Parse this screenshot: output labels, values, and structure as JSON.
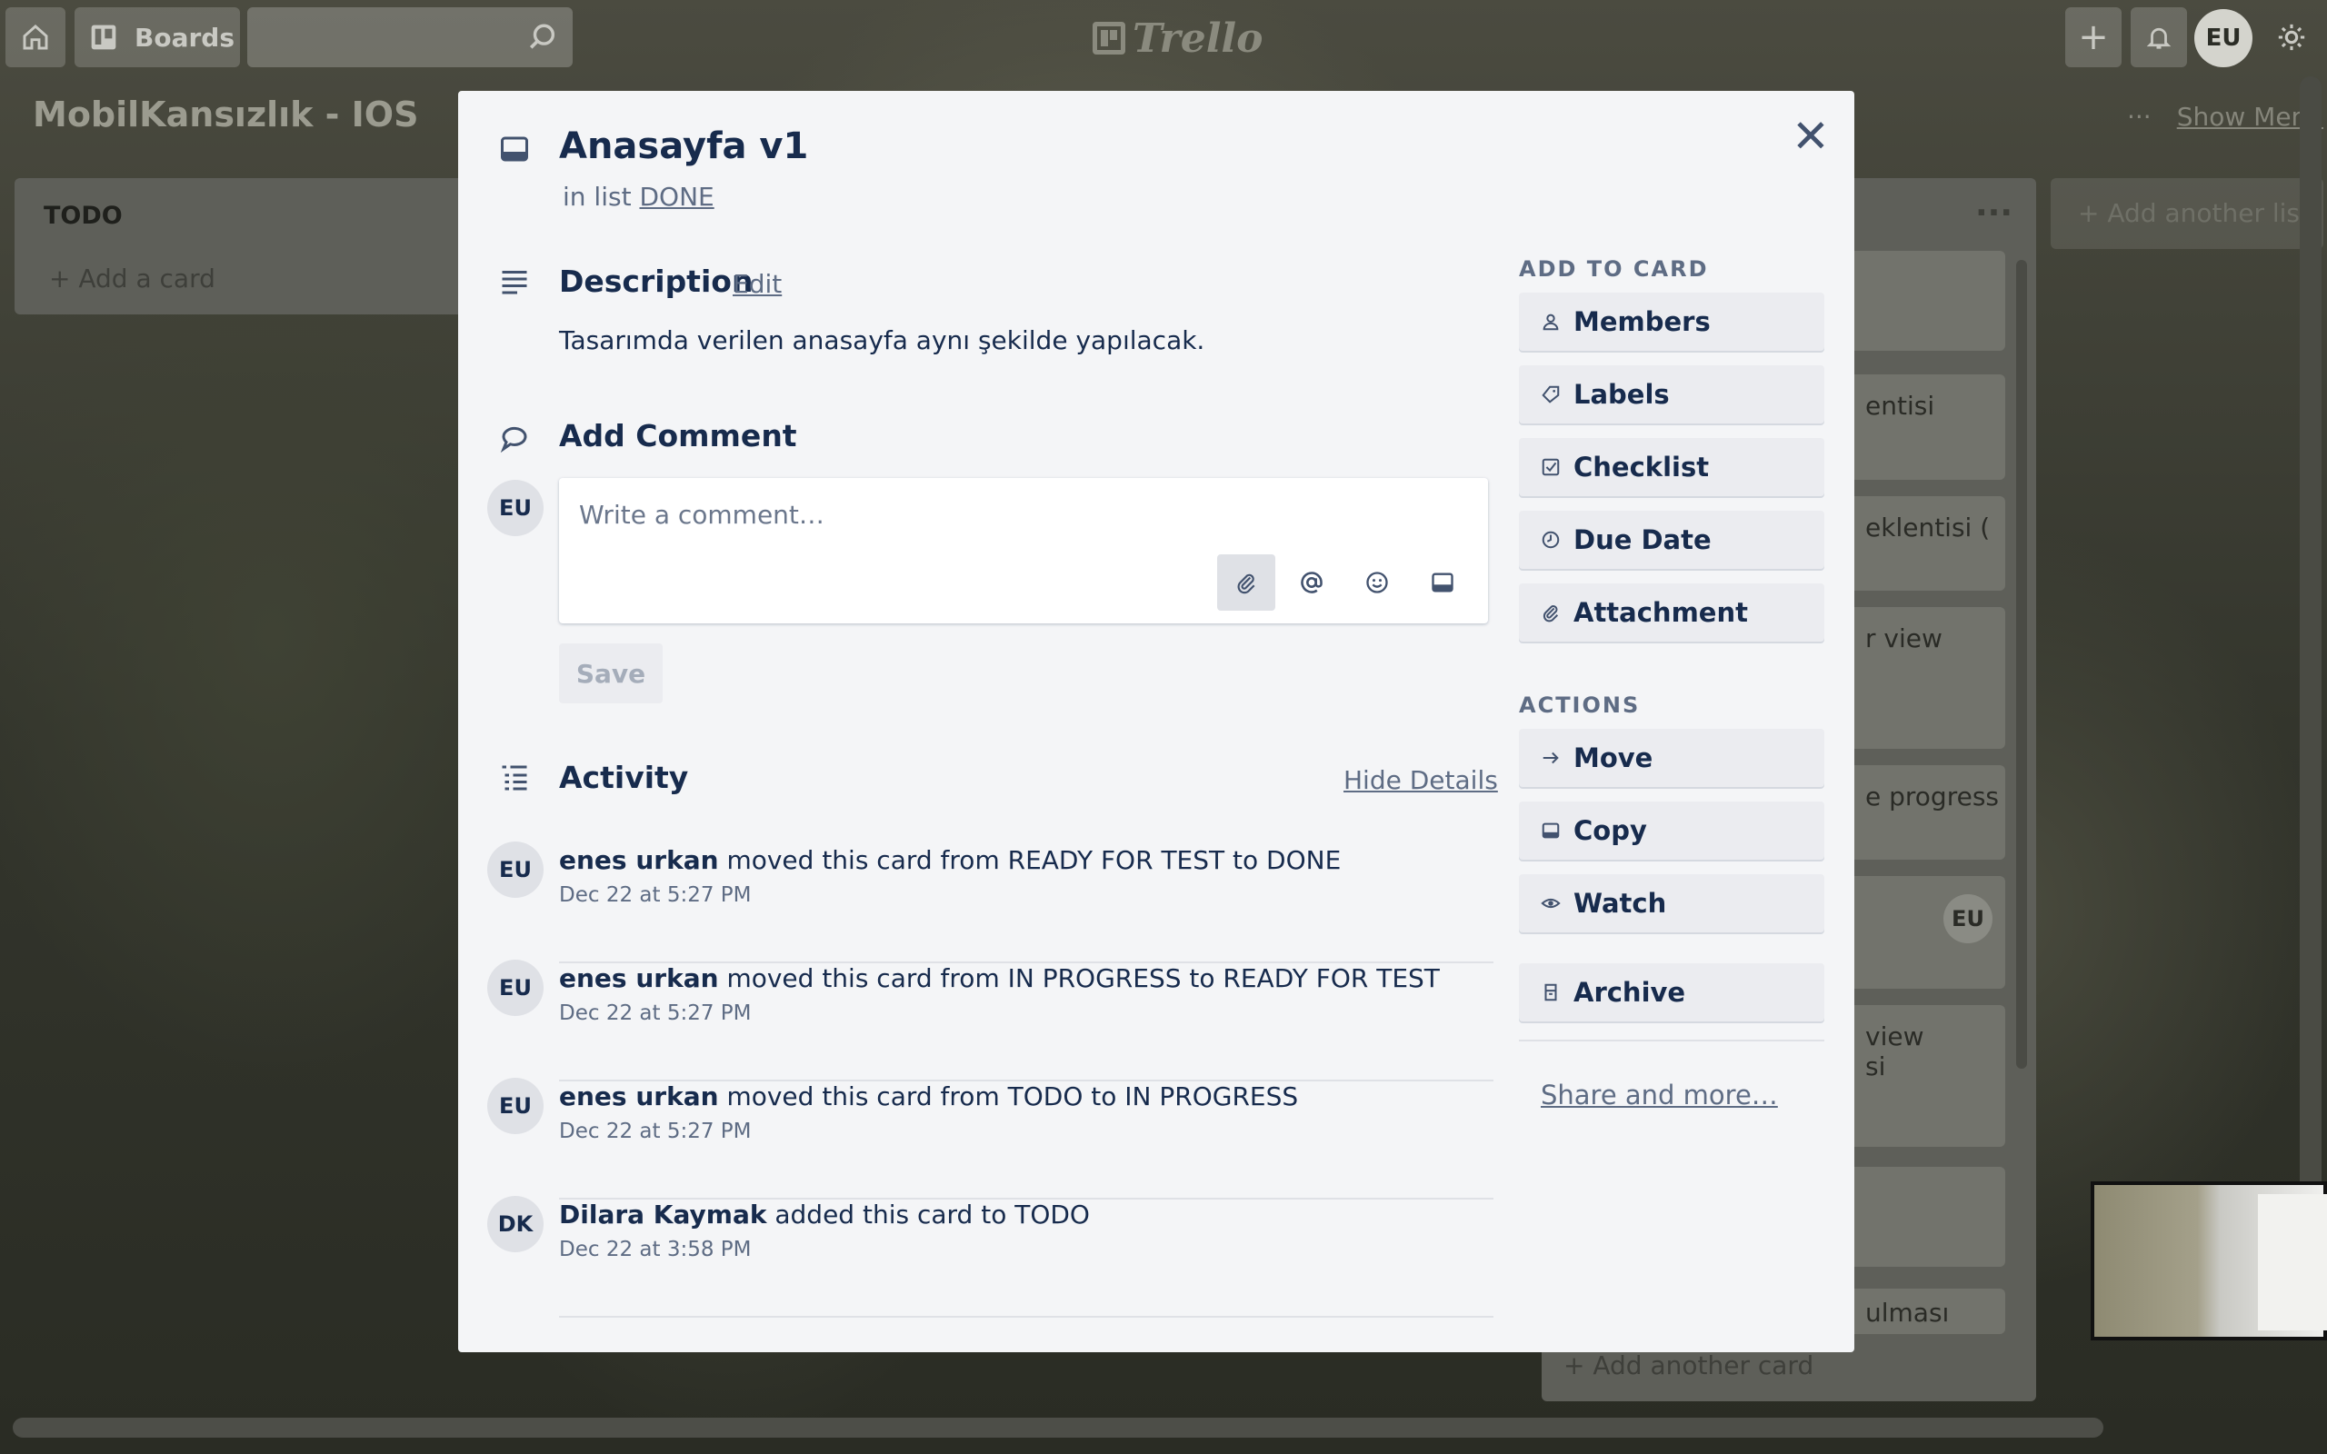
{
  "colors": {
    "modal_bg": "#f4f5f7",
    "primary_text": "#172b4d",
    "muted_text": "#5e6c84",
    "button_bg": "#ebecf0"
  },
  "topbar": {
    "boards_label": "Boards",
    "logo_text": "Trello",
    "user_initials": "EU",
    "icons": [
      "home-icon",
      "boards-icon",
      "search-icon",
      "plus-icon",
      "bell-icon",
      "gear-icon"
    ]
  },
  "board": {
    "name": "MobilKansızlık - IOS",
    "show_menu": "Show Menu",
    "lists": {
      "todo": {
        "title": "TODO",
        "add_card": "+ Add a card"
      },
      "done": {
        "card_fragments": [
          "",
          "entisi",
          "eklentisi (",
          "r view",
          "e progress",
          "",
          "view\nsi",
          "",
          "ulması"
        ],
        "avatar": "EU",
        "add_card": "+ Add another card"
      }
    },
    "add_list": "+ Add another list"
  },
  "card": {
    "title": "Anasayfa v1",
    "in_list_prefix": "in list",
    "list_name": "DONE",
    "description": {
      "heading": "Description",
      "edit_label": "Edit",
      "text": "Tasarımda verilen anasayfa aynı şekilde yapılacak."
    },
    "comment": {
      "heading": "Add Comment",
      "user_initials": "EU",
      "placeholder": "Write a comment…",
      "save_label": "Save"
    },
    "activity": {
      "heading": "Activity",
      "hide_details": "Hide Details",
      "items": [
        {
          "initials": "EU",
          "user": "enes urkan",
          "action": "moved this card from READY FOR TEST to DONE",
          "time": "Dec 22 at 5:27 PM"
        },
        {
          "initials": "EU",
          "user": "enes urkan",
          "action": "moved this card from IN PROGRESS to READY FOR TEST",
          "time": "Dec 22 at 5:27 PM"
        },
        {
          "initials": "EU",
          "user": "enes urkan",
          "action": "moved this card from TODO to IN PROGRESS",
          "time": "Dec 22 at 5:27 PM"
        },
        {
          "initials": "DK",
          "user": "Dilara Kaymak",
          "action": "added this card to TODO",
          "time": "Dec 22 at 3:58 PM"
        }
      ]
    },
    "sidebar": {
      "add_to_card_heading": "ADD TO CARD",
      "add_to_card": [
        "Members",
        "Labels",
        "Checklist",
        "Due Date",
        "Attachment"
      ],
      "actions_heading": "ACTIONS",
      "actions": [
        "Move",
        "Copy",
        "Watch"
      ],
      "archive": "Archive",
      "share_more": "Share and more…"
    }
  }
}
